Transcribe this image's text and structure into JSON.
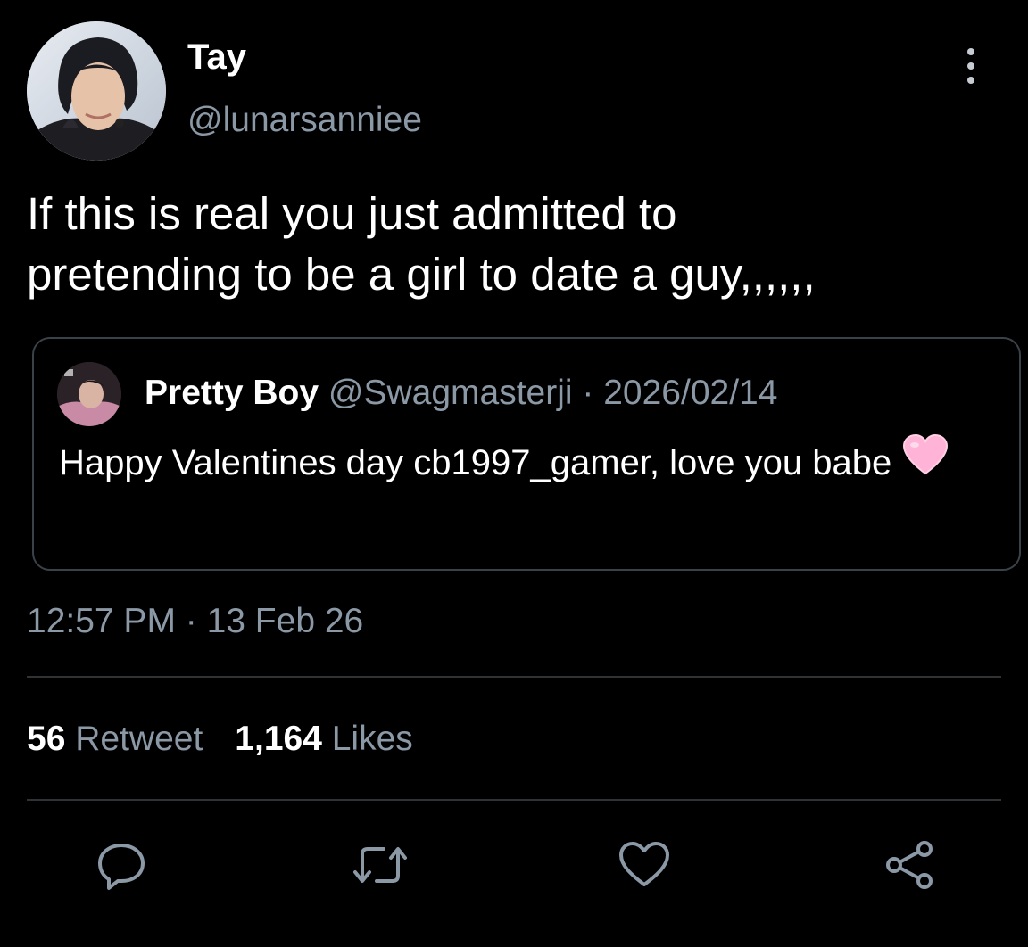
{
  "author": {
    "display_name": "Tay",
    "handle": "@lunarsanniee"
  },
  "tweet": {
    "text": "If this is real you just admitted to\npretending to be a girl to date a guy,,,,,,",
    "timestamp": "12:57 PM · 13 Feb 26"
  },
  "quoted_tweet": {
    "display_name": "Pretty Boy",
    "meta": " @Swagmasterji · 2026/02/14",
    "text": "Happy Valentines day cb1997_gamer, love you babe",
    "emoji": "pink-heart"
  },
  "stats": {
    "retweets_count": "56",
    "retweets_label": " Retweet",
    "likes_count": "1,164",
    "likes_label": " Likes"
  },
  "actions": [
    {
      "name": "reply",
      "icon": "speech-bubble-icon"
    },
    {
      "name": "retweet",
      "icon": "retweet-icon"
    },
    {
      "name": "like",
      "icon": "heart-icon"
    },
    {
      "name": "share",
      "icon": "share-icon"
    }
  ],
  "colors": {
    "background": "#000000",
    "primary_text": "#ffffff",
    "secondary_text": "#8b98a5",
    "border": "#2f3336",
    "heart_emoji": "#ffb3d6"
  }
}
